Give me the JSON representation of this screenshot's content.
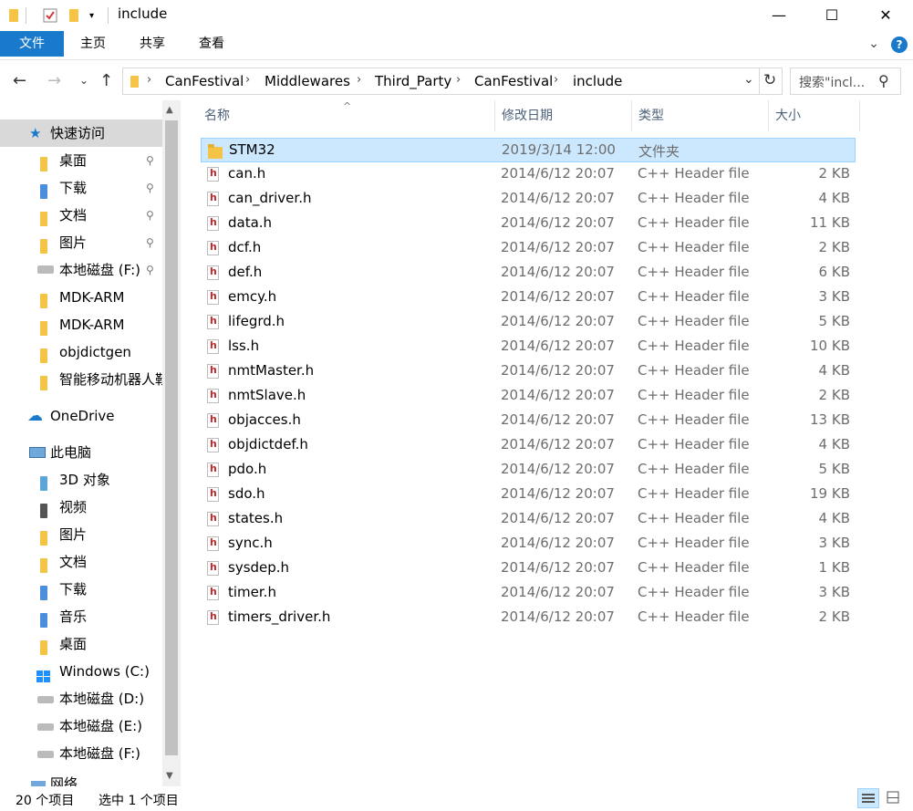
{
  "window": {
    "title": "include",
    "minimize": "—",
    "maximize": "☐",
    "close": "✕"
  },
  "ribbon": {
    "tabs": [
      "文件",
      "主页",
      "共享",
      "查看"
    ],
    "expand": "⌄",
    "help": "?"
  },
  "nav": {
    "back": "←",
    "forward": "→",
    "recent": "⌄",
    "up": "↑",
    "breadcrumb": [
      "CanFestival",
      "Middlewares",
      "Third_Party",
      "CanFestival",
      "include"
    ],
    "separator": "›",
    "dropdown": "⌄",
    "refresh": "↻",
    "search_placeholder": "搜索\"incl...",
    "search_icon": "⚲"
  },
  "sidebar": {
    "quick_access": "快速访问",
    "items": [
      {
        "label": "桌面",
        "pinned": true
      },
      {
        "label": "下载",
        "pinned": true
      },
      {
        "label": "文档",
        "pinned": true
      },
      {
        "label": "图片",
        "pinned": true
      },
      {
        "label": "本地磁盘 (F:)",
        "pinned": true
      },
      {
        "label": "MDK-ARM",
        "pinned": false
      },
      {
        "label": "MDK-ARM",
        "pinned": false
      },
      {
        "label": "objdictgen",
        "pinned": false
      },
      {
        "label": "智能移动机器人鞋",
        "pinned": false
      }
    ],
    "onedrive": "OneDrive",
    "this_pc": "此电脑",
    "pc_items": [
      "3D 对象",
      "视频",
      "图片",
      "文档",
      "下载",
      "音乐",
      "桌面",
      "Windows (C:)",
      "本地磁盘 (D:)",
      "本地磁盘 (E:)",
      "本地磁盘 (F:)"
    ],
    "partial": "网络",
    "pin_glyph": "📌"
  },
  "columns": {
    "name": "名称",
    "date": "修改日期",
    "type": "类型",
    "size": "大小",
    "sort_indicator": "^"
  },
  "files": [
    {
      "name": "STM32",
      "date": "2019/3/14 12:00",
      "type": "文件夹",
      "size": "",
      "kind": "folder"
    },
    {
      "name": "can.h",
      "date": "2014/6/12 20:07",
      "type": "C++ Header file",
      "size": "2 KB",
      "kind": "header"
    },
    {
      "name": "can_driver.h",
      "date": "2014/6/12 20:07",
      "type": "C++ Header file",
      "size": "4 KB",
      "kind": "header"
    },
    {
      "name": "data.h",
      "date": "2014/6/12 20:07",
      "type": "C++ Header file",
      "size": "11 KB",
      "kind": "header"
    },
    {
      "name": "dcf.h",
      "date": "2014/6/12 20:07",
      "type": "C++ Header file",
      "size": "2 KB",
      "kind": "header"
    },
    {
      "name": "def.h",
      "date": "2014/6/12 20:07",
      "type": "C++ Header file",
      "size": "6 KB",
      "kind": "header"
    },
    {
      "name": "emcy.h",
      "date": "2014/6/12 20:07",
      "type": "C++ Header file",
      "size": "3 KB",
      "kind": "header"
    },
    {
      "name": "lifegrd.h",
      "date": "2014/6/12 20:07",
      "type": "C++ Header file",
      "size": "5 KB",
      "kind": "header"
    },
    {
      "name": "lss.h",
      "date": "2014/6/12 20:07",
      "type": "C++ Header file",
      "size": "10 KB",
      "kind": "header"
    },
    {
      "name": "nmtMaster.h",
      "date": "2014/6/12 20:07",
      "type": "C++ Header file",
      "size": "4 KB",
      "kind": "header"
    },
    {
      "name": "nmtSlave.h",
      "date": "2014/6/12 20:07",
      "type": "C++ Header file",
      "size": "2 KB",
      "kind": "header"
    },
    {
      "name": "objacces.h",
      "date": "2014/6/12 20:07",
      "type": "C++ Header file",
      "size": "13 KB",
      "kind": "header"
    },
    {
      "name": "objdictdef.h",
      "date": "2014/6/12 20:07",
      "type": "C++ Header file",
      "size": "4 KB",
      "kind": "header"
    },
    {
      "name": "pdo.h",
      "date": "2014/6/12 20:07",
      "type": "C++ Header file",
      "size": "5 KB",
      "kind": "header"
    },
    {
      "name": "sdo.h",
      "date": "2014/6/12 20:07",
      "type": "C++ Header file",
      "size": "19 KB",
      "kind": "header"
    },
    {
      "name": "states.h",
      "date": "2014/6/12 20:07",
      "type": "C++ Header file",
      "size": "4 KB",
      "kind": "header"
    },
    {
      "name": "sync.h",
      "date": "2014/6/12 20:07",
      "type": "C++ Header file",
      "size": "3 KB",
      "kind": "header"
    },
    {
      "name": "sysdep.h",
      "date": "2014/6/12 20:07",
      "type": "C++ Header file",
      "size": "1 KB",
      "kind": "header"
    },
    {
      "name": "timer.h",
      "date": "2014/6/12 20:07",
      "type": "C++ Header file",
      "size": "3 KB",
      "kind": "header"
    },
    {
      "name": "timers_driver.h",
      "date": "2014/6/12 20:07",
      "type": "C++ Header file",
      "size": "2 KB",
      "kind": "header"
    }
  ],
  "status": {
    "count": "20 个项目",
    "selected": "选中 1 个项目"
  },
  "colors": {
    "accent": "#1979ca",
    "selection": "#cce8ff",
    "selection_border": "#99d1ff",
    "folder": "#f5c446",
    "header_icon": "#c0282b"
  },
  "icons": {
    "scroll_up": "▲",
    "scroll_down": "▼",
    "star": "★",
    "cloud": "☁",
    "pc": "🖥"
  }
}
